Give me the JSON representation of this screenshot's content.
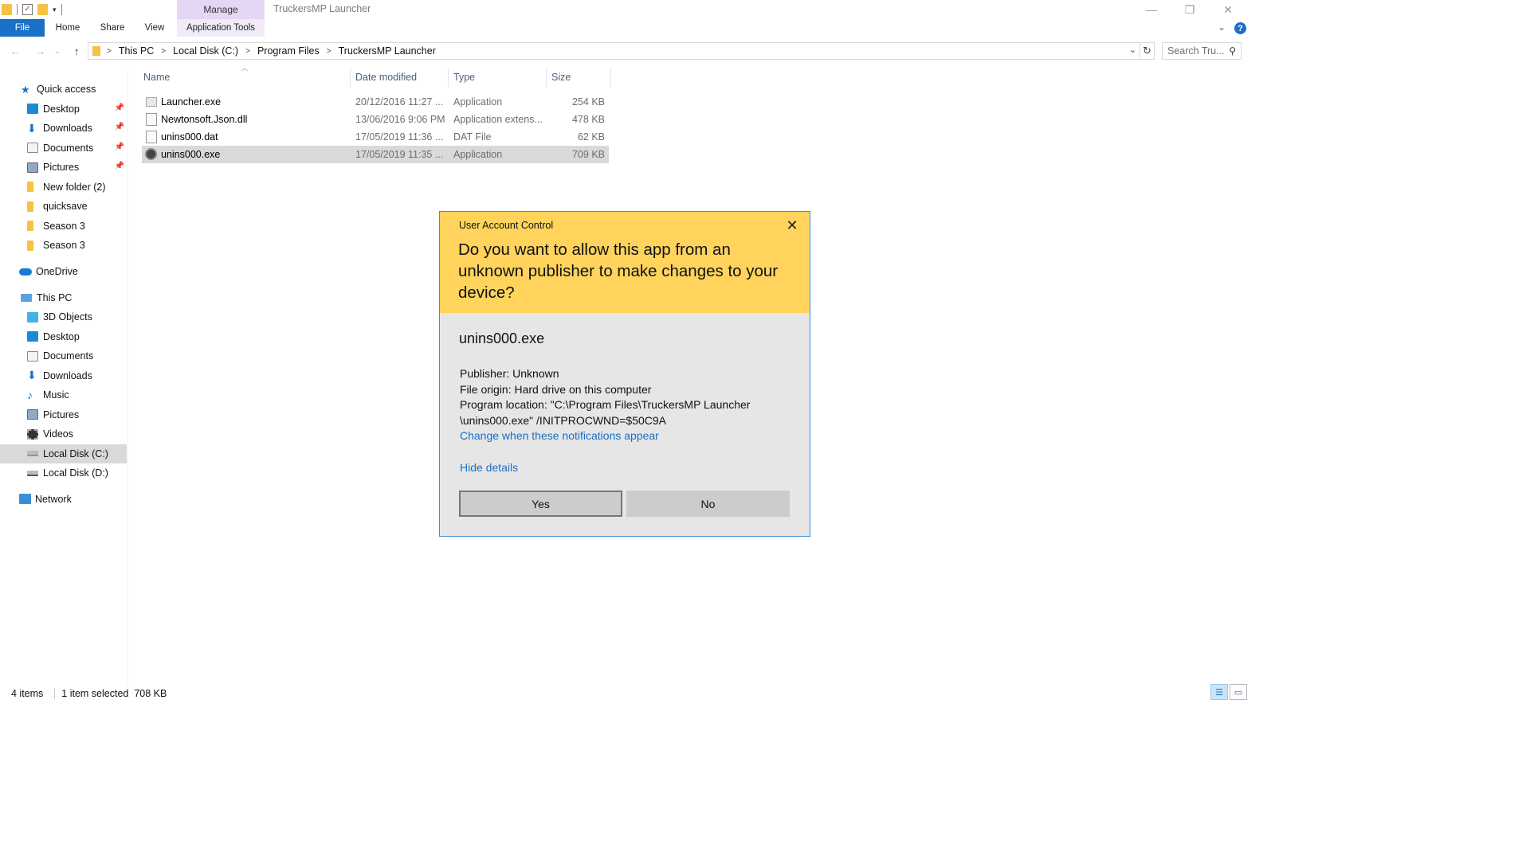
{
  "window": {
    "title": "TruckersMP Launcher",
    "manage_tab": "Manage"
  },
  "ribbon": {
    "tabs": [
      "File",
      "Home",
      "Share",
      "View",
      "Application Tools"
    ]
  },
  "address_bar": {
    "crumbs": [
      "This PC",
      "Local Disk (C:)",
      "Program Files",
      "TruckersMP Launcher"
    ]
  },
  "search": {
    "placeholder": "Search Tru..."
  },
  "nav_pane": {
    "quick_access": "Quick access",
    "quick_items": [
      "Desktop",
      "Downloads",
      "Documents",
      "Pictures",
      "New folder (2)",
      "quicksave",
      "Season 3",
      "Season 3"
    ],
    "onedrive": "OneDrive",
    "this_pc": "This PC",
    "pc_items": [
      "3D Objects",
      "Desktop",
      "Documents",
      "Downloads",
      "Music",
      "Pictures",
      "Videos",
      "Local Disk (C:)",
      "Local Disk (D:)"
    ],
    "network": "Network"
  },
  "file_list": {
    "columns": [
      "Name",
      "Date modified",
      "Type",
      "Size"
    ],
    "rows": [
      {
        "name": "Launcher.exe",
        "date": "20/12/2016 11:27 ...",
        "type": "Application",
        "size": "254 KB"
      },
      {
        "name": "Newtonsoft.Json.dll",
        "date": "13/06/2016 9:06 PM",
        "type": "Application extens...",
        "size": "478 KB"
      },
      {
        "name": "unins000.dat",
        "date": "17/05/2019 11:36 ...",
        "type": "DAT File",
        "size": "62 KB"
      },
      {
        "name": "unins000.exe",
        "date": "17/05/2019 11:35 ...",
        "type": "Application",
        "size": "709 KB"
      }
    ]
  },
  "status_bar": {
    "items": "4 items",
    "selected": "1 item selected  708 KB"
  },
  "uac": {
    "caption": "User Account Control",
    "question": "Do you want to allow this app from an unknown publisher to make changes to your device?",
    "app_name": "unins000.exe",
    "publisher": "Publisher: Unknown",
    "origin": "File origin: Hard drive on this computer",
    "location_1": "Program location: \"C:\\Program Files\\TruckersMP Launcher",
    "location_2": "\\unins000.exe\" /INITPROCWND=$50C9A",
    "change_link": "Change when these notifications appear",
    "hide_details": "Hide details",
    "yes": "Yes",
    "no": "No"
  }
}
